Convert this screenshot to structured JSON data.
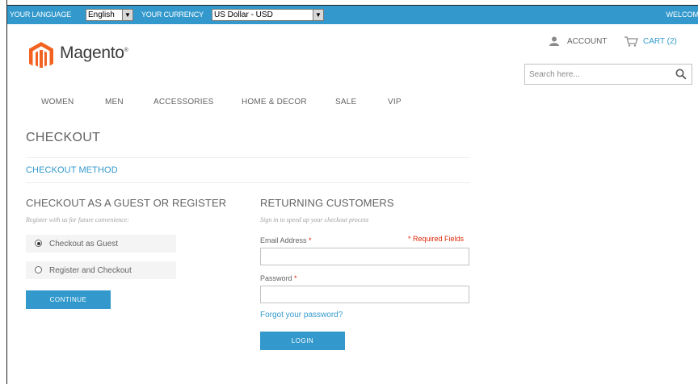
{
  "topbar": {
    "language_label": "YOUR LANGUAGE",
    "language_value": "English",
    "currency_label": "YOUR CURRENCY",
    "currency_value": "US Dollar - USD",
    "welcome": "WELCOM"
  },
  "brand": {
    "logo_text": "Magento",
    "accent": "#f26322"
  },
  "header": {
    "account": "ACCOUNT",
    "cart": "CART (2)",
    "search_placeholder": "Search here..."
  },
  "nav": [
    "WOMEN",
    "MEN",
    "ACCESSORIES",
    "HOME & DECOR",
    "SALE",
    "VIP"
  ],
  "checkout": {
    "title": "CHECKOUT",
    "method_step": "CHECKOUT METHOD",
    "guest": {
      "title": "CHECKOUT AS A GUEST OR REGISTER",
      "hint": "Register with us for future convenience:",
      "options": [
        {
          "label": "Checkout as Guest",
          "selected": true
        },
        {
          "label": "Register and Checkout",
          "selected": false
        }
      ],
      "continue_label": "CONTINUE"
    },
    "returning": {
      "title": "RETURNING CUSTOMERS",
      "hint": "Sign in to speed up your checkout process",
      "email_label": "Email Address",
      "password_label": "Password",
      "required_star": "*",
      "required_note": "* Required Fields",
      "forgot_label": "Forgot your password?",
      "login_label": "LOGIN"
    }
  },
  "colors": {
    "primary": "#3399cc",
    "required": "#df280a",
    "text": "#636363"
  }
}
